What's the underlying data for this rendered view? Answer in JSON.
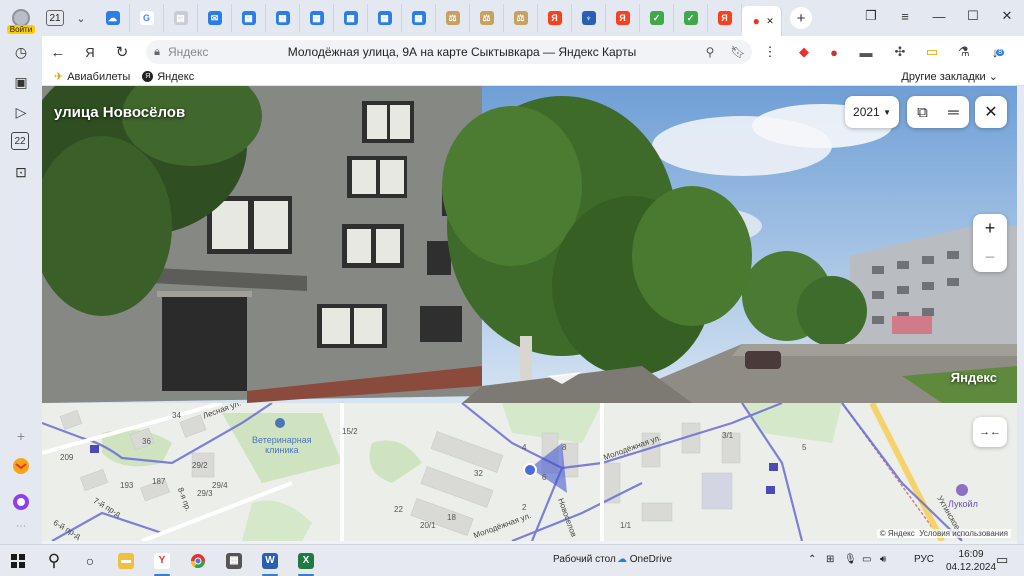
{
  "browser": {
    "profile_login_label": "Войти",
    "tab_count": "21",
    "tabs": [
      {
        "icon": "cloud-icon",
        "color": "#2b7de9",
        "glyph": "☁"
      },
      {
        "icon": "google-icon",
        "color": "#ffffff",
        "glyph": "G"
      },
      {
        "icon": "page-icon",
        "color": "#c8ccd4",
        "glyph": "▤"
      },
      {
        "icon": "mail-icon",
        "color": "#2b7de9",
        "glyph": "✉"
      },
      {
        "icon": "doc-icon",
        "color": "#2b7de9",
        "glyph": "▦"
      },
      {
        "icon": "doc-icon",
        "color": "#2b7de9",
        "glyph": "▦"
      },
      {
        "icon": "doc-icon",
        "color": "#2b7de9",
        "glyph": "▦"
      },
      {
        "icon": "doc-icon",
        "color": "#2b7de9",
        "glyph": "▦"
      },
      {
        "icon": "doc-icon",
        "color": "#2b7de9",
        "glyph": "▦"
      },
      {
        "icon": "doc-icon",
        "color": "#2b7de9",
        "glyph": "▦"
      },
      {
        "icon": "scales-icon",
        "color": "#c8a060",
        "glyph": "⚖"
      },
      {
        "icon": "scales-icon",
        "color": "#c8a060",
        "glyph": "⚖"
      },
      {
        "icon": "scales-icon",
        "color": "#c8a060",
        "glyph": "⚖"
      },
      {
        "icon": "yandex-icon",
        "color": "#fc3f1d",
        "glyph": "Я"
      },
      {
        "icon": "emblem-icon",
        "color": "#2b5fb4",
        "glyph": "♆"
      },
      {
        "icon": "yandex-icon",
        "color": "#fc3f1d",
        "glyph": "Я"
      },
      {
        "icon": "check-icon",
        "color": "#3fa84a",
        "glyph": "✓"
      },
      {
        "icon": "check-icon",
        "color": "#3fa84a",
        "glyph": "✓"
      },
      {
        "icon": "yandex-icon",
        "color": "#fc3f1d",
        "glyph": "Я"
      }
    ],
    "active_tab": {
      "icon": "map-pin-icon",
      "color": "#e8332d",
      "glyph": "●"
    },
    "address_site": "Яндекс",
    "page_title": "Молодёжная улица, 9А на карте Сыктывкара — Яндекс Карты",
    "bookmarks": [
      {
        "label": "Авиабилеты",
        "icon": "plane-icon",
        "glyph": "✈"
      },
      {
        "label": "Яндекс",
        "icon": "yandex-icon",
        "glyph": "Я"
      }
    ],
    "other_bookmarks": "Другие закладки",
    "sidebar_badge": "22",
    "download_badge": "8"
  },
  "panorama": {
    "street_name": "улица Новосёлов",
    "year": "2021",
    "logo": "Яндекс",
    "colors": {
      "sky": "#8fb6e3",
      "building": "#8e8f8a",
      "tree": "#3f6b2a",
      "road": "#8a8680"
    }
  },
  "map": {
    "poi": {
      "name_line1": "Ветеринарная",
      "name_line2": "клиника"
    },
    "poi2": "Лукойл",
    "streets": [
      "Лесная ул.",
      "Молодёжная ул.",
      "Молодёжная ул.",
      "Новоселов",
      "Ухтинское ш.",
      "8-я пр.",
      "7-й пр-д",
      "6-й пр-д"
    ],
    "house_numbers": [
      "34",
      "36",
      "209",
      "193",
      "187",
      "29/2",
      "29/3",
      "29/4",
      "15/2",
      "32",
      "18",
      "20/1",
      "22",
      "4",
      "6",
      "8",
      "2",
      "1/1",
      "3/1",
      "5"
    ],
    "route_badges": [
      "21",
      "21",
      "21"
    ],
    "copyright_text": "© Яндекс",
    "terms_text": "Условия использования"
  },
  "taskbar": {
    "desktop_label": "Рабочий стол",
    "onedrive_label": "OneDrive",
    "language": "РУС",
    "time": "16:09",
    "date": "04.12.2024"
  }
}
